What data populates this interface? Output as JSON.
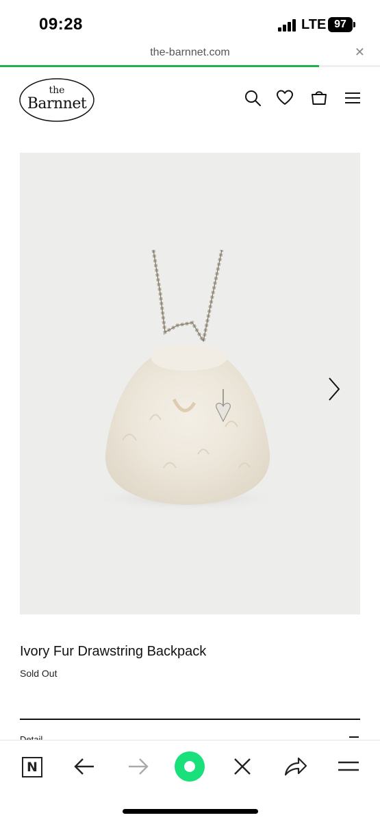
{
  "status_bar": {
    "time": "09:28",
    "network": "LTE",
    "battery": "97",
    "icons": [
      "signal-icon",
      "battery-icon"
    ]
  },
  "browser": {
    "url": "the-barnnet.com",
    "close_glyph": "✕",
    "load_progress_percent": 84
  },
  "site_header": {
    "logo_small": "the",
    "logo_main": "Barnnet",
    "icons": [
      "search-icon",
      "heart-icon",
      "bag-icon",
      "menu-icon"
    ]
  },
  "product": {
    "title": "Ivory Fur Drawstring Backpack",
    "status": "Sold Out",
    "image_description_icon": "product-photo",
    "next_icon": "chevron-right-icon"
  },
  "details": {
    "label": "Detail"
  },
  "toolbar": {
    "n_label": "N",
    "icons": [
      "n-app-icon",
      "back-arrow-icon",
      "forward-arrow-icon",
      "record-icon",
      "close-icon",
      "share-icon",
      "menu-icon"
    ]
  },
  "colors": {
    "accent": "#19b34a",
    "record": "#19e07a",
    "image_bg": "#ededec"
  }
}
